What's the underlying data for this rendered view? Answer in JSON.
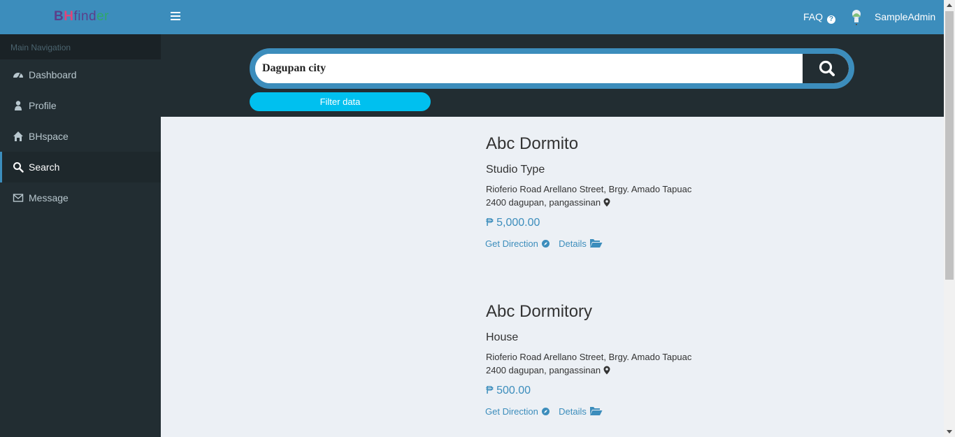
{
  "header": {
    "logo": {
      "b": "B",
      "h": "H",
      "find": "find",
      "er": "er"
    },
    "faq_label": "FAQ",
    "user_name": "SampleAdmin"
  },
  "sidebar": {
    "header": "Main Navigation",
    "items": [
      {
        "label": "Dashboard",
        "icon": "dashboard-icon"
      },
      {
        "label": "Profile",
        "icon": "user-icon"
      },
      {
        "label": "BHspace",
        "icon": "home-icon"
      },
      {
        "label": "Search",
        "icon": "search-icon",
        "active": true
      },
      {
        "label": "Message",
        "icon": "envelope-icon"
      }
    ]
  },
  "search": {
    "value": "Dagupan city",
    "filter_label": "Filter data"
  },
  "listings": [
    {
      "title": "Abc Dormito",
      "type": "Studio Type",
      "address_line1": "Rioferio Road Arellano Street, Brgy. Amado Tapuac",
      "address_line2": "2400 dagupan, pangassinan",
      "price": "₱ 5,000.00",
      "direction_label": "Get Direction",
      "details_label": "Details"
    },
    {
      "title": "Abc Dormitory",
      "type": "House",
      "address_line1": "Rioferio Road Arellano Street, Brgy. Amado Tapuac",
      "address_line2": "2400 dagupan, pangassinan",
      "price": "₱ 500.00",
      "direction_label": "Get Direction",
      "details_label": "Details"
    }
  ],
  "colors": {
    "header": "#3c8dbc",
    "sidebar": "#222d32",
    "accent": "#00c0ef",
    "content_bg": "#ecf0f5"
  }
}
